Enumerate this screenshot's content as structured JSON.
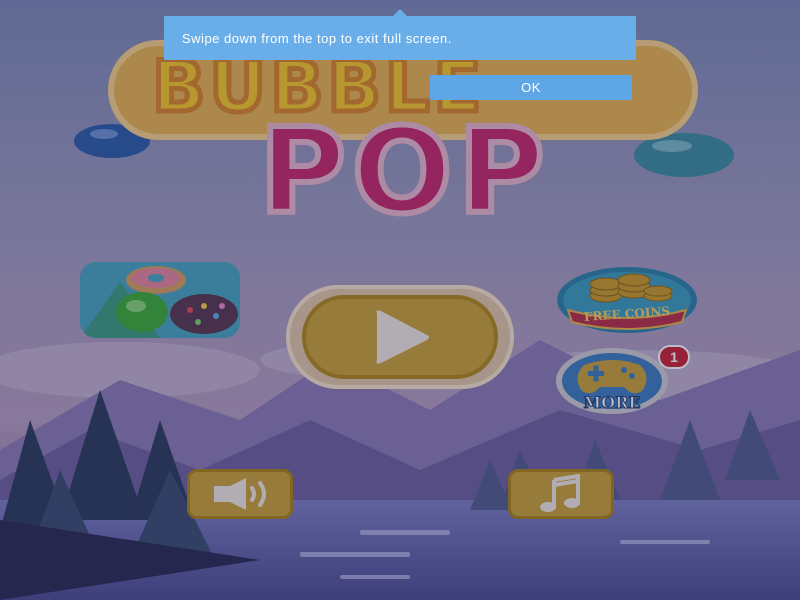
{
  "fullscreen_notice": {
    "message": "Swipe down from the top to exit full screen.",
    "ok_label": "OK"
  },
  "title": {
    "line1": "BUBBLE",
    "line2": "POP"
  },
  "menu": {
    "free_coins_label": "FREE COINS",
    "more_label": "MORE",
    "more_badge_count": "1",
    "play_icon": "play-icon",
    "sound_icon": "speaker-icon",
    "music_icon": "music-note-icon",
    "promo_icon": "candy-game-icon"
  },
  "colors": {
    "toast_blue": "#6aaee9",
    "play_gold": "#c9a23a",
    "badge_red": "#c8283a",
    "title_pink": "#c72c6c"
  }
}
